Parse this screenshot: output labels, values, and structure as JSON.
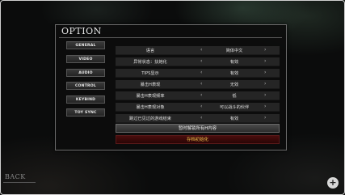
{
  "title": "OPTION",
  "sidebar": {
    "items": [
      {
        "label": "GENERAL"
      },
      {
        "label": "VIDEO"
      },
      {
        "label": "AUDIO"
      },
      {
        "label": "CONTROL"
      },
      {
        "label": "KEYBIND"
      },
      {
        "label": "TOY SYNC"
      }
    ]
  },
  "settings": {
    "rows": [
      {
        "label": "语言",
        "value": "简体中文"
      },
      {
        "label": "异常状态：扶她化",
        "value": "有效"
      },
      {
        "label": "TIPS显示",
        "value": "有效"
      },
      {
        "label": "暴击H表现",
        "value": "无效"
      },
      {
        "label": "暴击H表现频率",
        "value": "低"
      },
      {
        "label": "暴击H表现对象",
        "value": "可以战斗的伙伴"
      },
      {
        "label": "跳过已见过的游戏结束",
        "value": "有效"
      }
    ],
    "arrow_left": "‹",
    "arrow_right": "›"
  },
  "actions": {
    "clear_label": "暂时解锁所有H内容",
    "init_label": "存档初始化"
  },
  "footer": {
    "back_label": "BACK",
    "corner_icon": "+"
  },
  "colors": {
    "init_text": "#f0c24a",
    "init_bg": "#3a0a0a"
  }
}
